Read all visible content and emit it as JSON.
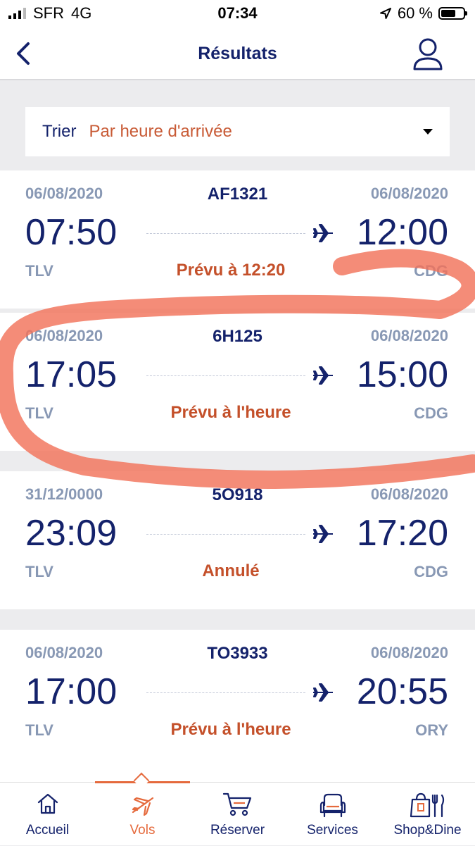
{
  "status_bar": {
    "carrier": "SFR",
    "network": "4G",
    "time": "07:34",
    "battery": "60 %"
  },
  "header": {
    "title": "Résultats"
  },
  "sort": {
    "label": "Trier",
    "value": "Par heure d'arrivée"
  },
  "flights": [
    {
      "dep_date": "06/08/2020",
      "flight_no": "AF1321",
      "arr_date": "06/08/2020",
      "dep_time": "07:50",
      "arr_time": "12:00",
      "origin": "TLV",
      "status": "Prévu à 12:20",
      "destination": "CDG"
    },
    {
      "dep_date": "06/08/2020",
      "flight_no": "6H125",
      "arr_date": "06/08/2020",
      "dep_time": "17:05",
      "arr_time": "15:00",
      "origin": "TLV",
      "status": "Prévu à l'heure",
      "destination": "CDG"
    },
    {
      "dep_date": "31/12/0000",
      "flight_no": "5O918",
      "arr_date": "06/08/2020",
      "dep_time": "23:09",
      "arr_time": "17:20",
      "origin": "TLV",
      "status": "Annulé",
      "destination": "CDG"
    },
    {
      "dep_date": "06/08/2020",
      "flight_no": "TO3933",
      "arr_date": "06/08/2020",
      "dep_time": "17:00",
      "arr_time": "20:55",
      "origin": "TLV",
      "status": "Prévu à l'heure",
      "destination": "ORY"
    }
  ],
  "tabs": [
    {
      "label": "Accueil",
      "icon": "home-icon",
      "active": false
    },
    {
      "label": "Vols",
      "icon": "plane-icon",
      "active": true
    },
    {
      "label": "Réserver",
      "icon": "cart-icon",
      "active": false
    },
    {
      "label": "Services",
      "icon": "armchair-icon",
      "active": false
    },
    {
      "label": "Shop&Dine",
      "icon": "shopping-bag-icon",
      "active": false
    }
  ],
  "colors": {
    "primary": "#14226b",
    "accent": "#e56a3d",
    "status": "#c4502a",
    "muted": "#8898b4",
    "annotation": "#f2735a"
  }
}
